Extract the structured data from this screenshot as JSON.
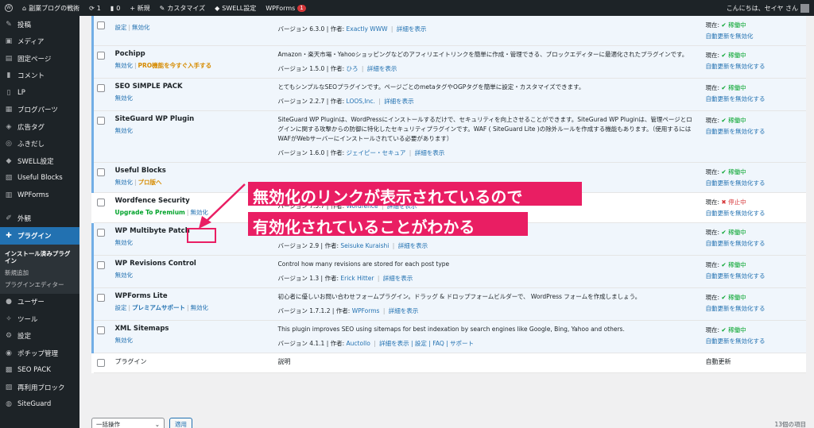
{
  "adminbar": {
    "site_name": "副業ブログの戦術",
    "updates": "1",
    "comments": "0",
    "new": "+ 新規",
    "customize": "カスタマイズ",
    "swell": "SWELL設定",
    "wpforms": "WPForms",
    "wpforms_badge": "1",
    "greeting": "こんにちは、セイヤ さん"
  },
  "sidebar": {
    "items": [
      {
        "label": "投稿",
        "icon": "pin-icon"
      },
      {
        "label": "メディア",
        "icon": "media-icon"
      },
      {
        "label": "固定ページ",
        "icon": "page-icon"
      },
      {
        "label": "コメント",
        "icon": "comment-icon"
      },
      {
        "label": "LP",
        "icon": "lp-icon"
      },
      {
        "label": "ブログパーツ",
        "icon": "parts-icon"
      },
      {
        "label": "広告タグ",
        "icon": "tag-icon"
      },
      {
        "label": "ふきだし",
        "icon": "balloon-icon"
      },
      {
        "label": "SWELL設定",
        "icon": "swell-icon"
      },
      {
        "label": "Useful Blocks",
        "icon": "blocks-icon"
      },
      {
        "label": "WPForms",
        "icon": "forms-icon"
      },
      {
        "label": "外観",
        "icon": "appearance-icon"
      },
      {
        "label": "プラグイン",
        "icon": "plugin-icon"
      },
      {
        "label": "ユーザー",
        "icon": "user-icon"
      },
      {
        "label": "ツール",
        "icon": "tool-icon"
      },
      {
        "label": "設定",
        "icon": "settings-icon"
      },
      {
        "label": "ポチップ管理",
        "icon": "pochipp-icon"
      },
      {
        "label": "SEO PACK",
        "icon": "seo-icon"
      },
      {
        "label": "再利用ブロック",
        "icon": "reuse-icon"
      },
      {
        "label": "SiteGuard",
        "icon": "siteguard-icon"
      }
    ],
    "submenu": [
      "インストール済みプラグイン",
      "新規追加",
      "プラグインエディター"
    ]
  },
  "plugins": [
    {
      "name": "",
      "actions": [
        {
          "t": "設定"
        },
        {
          "t": "無効化"
        }
      ],
      "desc": "",
      "version": "バージョン 6.3.0 | 作者:",
      "author": "Exactly WWW",
      "details": "詳細を表示",
      "status": "現在:",
      "state": "✔ 稼働中",
      "auto": "自動更新を無効化"
    },
    {
      "name": "Pochipp",
      "actions": [
        {
          "t": "無効化"
        },
        {
          "t": "PRO機能を今すぐ入手する",
          "c": "pro"
        }
      ],
      "desc": "Amazon・楽天市場・Yahooショッピングなどのアフィリエイトリンクを簡単に作成・管理できる、ブロックエディターに最適化されたプラグインです。",
      "version": "バージョン 1.5.0 | 作者:",
      "author": "ひろ",
      "details": "詳細を表示",
      "status": "現在:",
      "state": "✔ 稼働中",
      "auto": "自動更新を無効化する"
    },
    {
      "name": "SEO SIMPLE PACK",
      "actions": [
        {
          "t": "無効化"
        }
      ],
      "desc": "とてもシンプルなSEOプラグインです。ページごとのmetaタグやOGPタグを簡単に設定・カスタマイズできます。",
      "version": "バージョン 2.2.7 | 作者:",
      "author": "LOOS,Inc.",
      "details": "詳細を表示",
      "status": "現在:",
      "state": "✔ 稼働中",
      "auto": "自動更新を無効化する"
    },
    {
      "name": "SiteGuard WP Plugin",
      "actions": [
        {
          "t": "無効化"
        }
      ],
      "desc": "SiteGuard WP Pluginは、WordPressにインストールするだけで、セキュリティを向上させることができます。SiteGurad WP Pluginは、管理ページとログインに関する攻撃からの防御に特化したセキュリティプラグインです。WAF ( SiteGuard Lite )の除外ルールを作成する機能もあります。（使用するにはWAFがWebサーバーにインストールされている必要があります）",
      "version": "バージョン 1.6.0 | 作者:",
      "author": "ジェイピー・セキュア",
      "details": "詳細を表示",
      "status": "現在:",
      "state": "✔ 稼働中",
      "auto": "自動更新を無効化する"
    },
    {
      "name": "Useful Blocks",
      "actions": [
        {
          "t": "無効化"
        },
        {
          "t": "プロ版へ",
          "c": "pro"
        }
      ],
      "desc": "",
      "version": "",
      "author": "",
      "details": "",
      "status": "現在:",
      "state": "✔ 稼働中",
      "auto": "自動更新を無効化する"
    },
    {
      "name": "Wordfence Security",
      "actions": [
        {
          "t": "Upgrade To Premium",
          "c": "up"
        },
        {
          "t": "無効化"
        }
      ],
      "desc": "",
      "version": "バージョン 7.5.7 | 作者:",
      "author": "Wordfence",
      "details": "詳細を表示",
      "status": "現在:",
      "state": "✖ 停止中",
      "auto": "自動更新を無効化する"
    },
    {
      "name": "WP Multibyte Patch",
      "actions": [
        {
          "t": "無効化"
        }
      ],
      "desc": "Multibyte functionality enhancement for the WordPress Japanese package.",
      "version": "バージョン 2.9 | 作者:",
      "author": "Seisuke Kuraishi",
      "details": "詳細を表示",
      "status": "現在:",
      "state": "✔ 稼働中",
      "auto": "自動更新を無効化する"
    },
    {
      "name": "WP Revisions Control",
      "actions": [
        {
          "t": "無効化"
        }
      ],
      "desc": "Control how many revisions are stored for each post type",
      "version": "バージョン 1.3 | 作者:",
      "author": "Erick Hitter",
      "details": "詳細を表示",
      "status": "現在:",
      "state": "✔ 稼働中",
      "auto": "自動更新を無効化する"
    },
    {
      "name": "WPForms Lite",
      "actions": [
        {
          "t": "設定"
        },
        {
          "t": "プレミアムサポート",
          "c": "bold"
        },
        {
          "t": "無効化"
        }
      ],
      "desc": "初心者に優しいお問い合わせフォームプラグイン。ドラッグ & ドロップフォームビルダーで、 WordPress フォームを作成しましょう。",
      "version": "バージョン 1.7.1.2 | 作者:",
      "author": "WPForms",
      "details": "詳細を表示",
      "status": "現在:",
      "state": "✔ 稼働中",
      "auto": "自動更新を無効化する"
    },
    {
      "name": "XML Sitemaps",
      "actions": [
        {
          "t": "無効化"
        }
      ],
      "desc": "This plugin improves SEO using sitemaps for best indexation by search engines like Google, Bing, Yahoo and others.",
      "version": "バージョン 4.1.1 | 作者:",
      "author": "Auctollo",
      "details": "詳細を表示 | 設定 | FAQ | サポート",
      "status": "現在:",
      "state": "✔ 稼働中",
      "auto": "自動更新を無効化する"
    }
  ],
  "footer": {
    "col_plugin": "プラグイン",
    "col_desc": "説明",
    "col_auto": "自動更新"
  },
  "bulk": {
    "select": "一括操作",
    "apply": "適用",
    "count": "13個の項目"
  },
  "annotation": {
    "line1": "無効化のリンクが表示されているので",
    "line2": "有効化されていることがわかる"
  },
  "colors": {
    "accent": "#2271b1",
    "annotation": "#e91e63",
    "active_row": "#f0f6fc"
  }
}
